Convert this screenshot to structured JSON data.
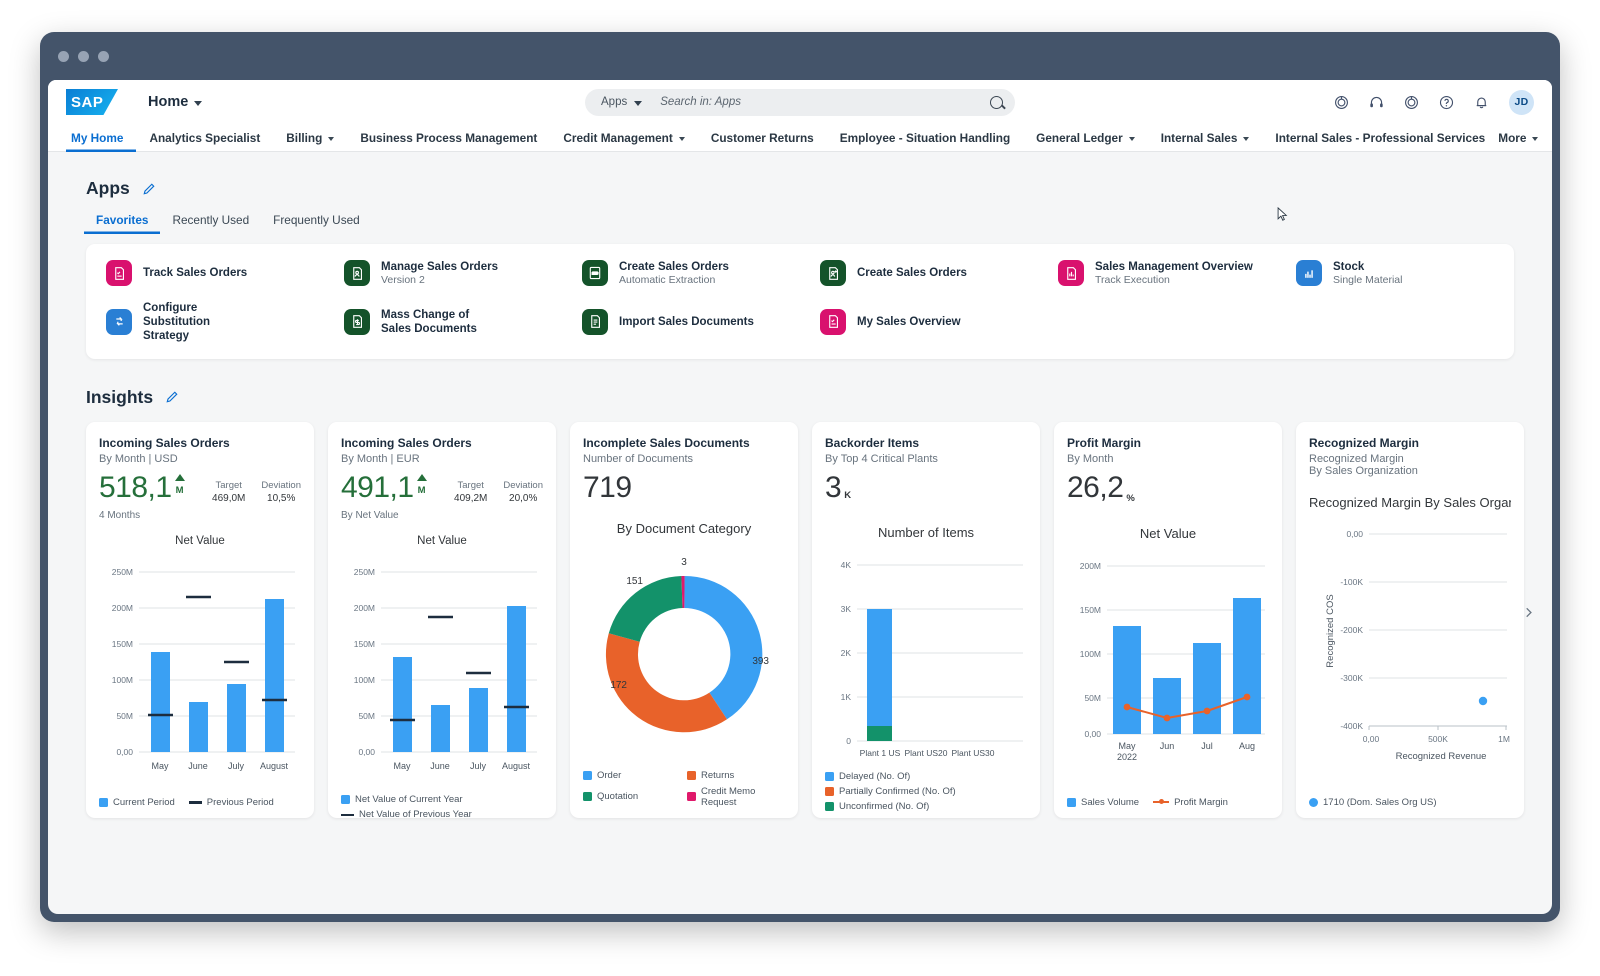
{
  "shell": {
    "logo_text": "SAP",
    "home_label": "Home",
    "search": {
      "scope": "Apps",
      "placeholder": "Search in: Apps",
      "value": ""
    },
    "icons": [
      {
        "name": "spiral-icon",
        "title": "Spiral"
      },
      {
        "name": "headset-icon",
        "title": "Support"
      },
      {
        "name": "spiral2-icon",
        "title": "Copilot"
      },
      {
        "name": "help-icon",
        "title": "Help"
      },
      {
        "name": "bell-icon",
        "title": "Notifications"
      }
    ],
    "avatar_initials": "JD"
  },
  "nav": {
    "items": [
      {
        "label": "My Home",
        "active": true,
        "caret": false
      },
      {
        "label": "Analytics Specialist",
        "active": false,
        "caret": false
      },
      {
        "label": "Billing",
        "active": false,
        "caret": true
      },
      {
        "label": "Business Process Management",
        "active": false,
        "caret": false
      },
      {
        "label": "Credit Management",
        "active": false,
        "caret": true
      },
      {
        "label": "Customer Returns",
        "active": false,
        "caret": false
      },
      {
        "label": "Employee - Situation Handling",
        "active": false,
        "caret": false
      },
      {
        "label": "General Ledger",
        "active": false,
        "caret": true
      },
      {
        "label": "Internal Sales",
        "active": false,
        "caret": true
      },
      {
        "label": "Internal Sales - Professional Services",
        "active": false,
        "caret": false
      }
    ],
    "more_label": "More"
  },
  "apps_section": {
    "title": "Apps",
    "tabs": [
      {
        "label": "Favorites",
        "active": true
      },
      {
        "label": "Recently Used",
        "active": false
      },
      {
        "label": "Frequently Used",
        "active": false
      }
    ],
    "items": [
      {
        "title": "Track Sales Orders",
        "sub": "",
        "color": "#d9116e",
        "icon": "track-sales-orders-icon"
      },
      {
        "title": "Manage Sales Orders",
        "sub": "Version 2",
        "color": "#14532a",
        "icon": "manage-sales-orders-icon"
      },
      {
        "title": "Create Sales Orders",
        "sub": "Automatic Extraction",
        "color": "#14532a",
        "icon": "pdf-icon"
      },
      {
        "title": "Create Sales Orders",
        "sub": "",
        "color": "#14532a",
        "icon": "create-sales-orders-icon"
      },
      {
        "title": "Sales Management Overview",
        "sub": "Track Execution",
        "color": "#d9116e",
        "icon": "sales-overview-icon"
      },
      {
        "title": "Stock",
        "sub": "Single Material",
        "color": "#2a7fd4",
        "icon": "stock-bars-icon"
      },
      {
        "title": "Configure Substitution Strategy",
        "sub": "",
        "color": "#2a7fd4",
        "icon": "substitution-icon"
      },
      {
        "title": "Mass Change of Sales Documents",
        "sub": "",
        "color": "#14532a",
        "icon": "mass-change-icon"
      },
      {
        "title": "Import Sales Documents",
        "sub": "",
        "color": "#14532a",
        "icon": "import-docs-icon"
      },
      {
        "title": "My Sales Overview",
        "sub": "",
        "color": "#d9116e",
        "icon": "my-sales-overview-icon"
      }
    ]
  },
  "insights_section": {
    "title": "Insights"
  },
  "chart_data": [
    {
      "card_title": "Incoming Sales Orders",
      "card_sub": "By Month | USD",
      "kpi": {
        "value": "518,1",
        "unit": "M",
        "trend": "up",
        "footer": "4 Months"
      },
      "meta": [
        {
          "label": "Target",
          "value": "469,0M"
        },
        {
          "label": "Deviation",
          "value": "10,5%"
        }
      ],
      "type": "bar",
      "title": "Net Value",
      "categories": [
        "May",
        "June",
        "July",
        "August"
      ],
      "series": [
        {
          "name": "Current Period",
          "values": [
            139,
            70,
            95,
            213
          ],
          "color": "#3aa0f3"
        },
        {
          "name": "Previous Period",
          "values": [
            52,
            216,
            125,
            73
          ],
          "color": "#1d2d3e"
        }
      ],
      "ytick_labels": [
        "250M",
        "200M",
        "150M",
        "100M",
        "50M",
        "0,00"
      ],
      "ylim": [
        0,
        250
      ],
      "legend": [
        {
          "label": "Current Period",
          "marker": "square",
          "color": "#3aa0f3"
        },
        {
          "label": "Previous Period",
          "marker": "line",
          "color": "#1d2d3e"
        }
      ]
    },
    {
      "card_title": "Incoming Sales Orders",
      "card_sub": "By Month | EUR",
      "kpi": {
        "value": "491,1",
        "unit": "M",
        "trend": "up",
        "footer": "By Net Value"
      },
      "meta": [
        {
          "label": "Target",
          "value": "409,2M"
        },
        {
          "label": "Deviation",
          "value": "20,0%"
        }
      ],
      "type": "bar",
      "title": "Net Value",
      "categories": [
        "May",
        "June",
        "July",
        "August"
      ],
      "series": [
        {
          "name": "Net Value of Current Year",
          "values": [
            132,
            65,
            89,
            203
          ],
          "color": "#3aa0f3"
        },
        {
          "name": "Net Value of Previous Year",
          "values": [
            45,
            188,
            110,
            63
          ],
          "color": "#1d2d3e"
        }
      ],
      "ytick_labels": [
        "250M",
        "200M",
        "150M",
        "100M",
        "50M",
        "0,00"
      ],
      "ylim": [
        0,
        250
      ],
      "legend": [
        {
          "label": "Net Value of Current Year",
          "marker": "square",
          "color": "#3aa0f3"
        },
        {
          "label": "Net Value of Previous Year",
          "marker": "line",
          "color": "#1d2d3e"
        }
      ]
    },
    {
      "card_title": "Incomplete Sales Documents",
      "card_sub": "Number of Documents",
      "kpi": {
        "value": "719",
        "unit": "",
        "trend": "none",
        "footer": ""
      },
      "meta": [],
      "type": "pie",
      "title": "By Document Category",
      "categories": [
        "Order",
        "Returns",
        "Quotation",
        "Credit Memo Request"
      ],
      "values": [
        393,
        172,
        151,
        3
      ],
      "colors": [
        "#3aa0f3",
        "#e8622a",
        "#13926a",
        "#e0196b"
      ],
      "data_labels": [
        "393",
        "172",
        "151",
        "3"
      ],
      "legend": [
        {
          "label": "Order",
          "marker": "square",
          "color": "#3aa0f3"
        },
        {
          "label": "Returns",
          "marker": "square",
          "color": "#e8622a"
        },
        {
          "label": "Quotation",
          "marker": "square",
          "color": "#13926a"
        },
        {
          "label": "Credit Memo Request",
          "marker": "square",
          "color": "#e0196b"
        }
      ]
    },
    {
      "card_title": "Backorder Items",
      "card_sub": "By Top 4 Critical Plants",
      "kpi": {
        "value": "3",
        "unit": "K",
        "trend": "none",
        "footer": ""
      },
      "meta": [],
      "type": "bar",
      "title": "Number of Items",
      "categories": [
        "Plant 1 US",
        "Plant US20",
        "Plant US30"
      ],
      "series": [
        {
          "name": "Delayed (No. Of)",
          "values": [
            2650,
            0,
            0
          ],
          "color": "#3aa0f3"
        },
        {
          "name": "Partially Confirmed (No. Of)",
          "values": [
            0,
            0,
            0
          ],
          "color": "#e8622a"
        },
        {
          "name": "Unconfirmed (No. Of)",
          "values": [
            350,
            0,
            0
          ],
          "color": "#13926a"
        }
      ],
      "ytick_labels": [
        "4K",
        "3K",
        "2K",
        "1K",
        "0"
      ],
      "ylim": [
        0,
        4000
      ],
      "legend": [
        {
          "label": "Delayed (No. Of)",
          "marker": "square",
          "color": "#3aa0f3"
        },
        {
          "label": "Partially Confirmed (No. Of)",
          "marker": "square",
          "color": "#e8622a"
        },
        {
          "label": "Unconfirmed (No. Of)",
          "marker": "square",
          "color": "#13926a"
        }
      ]
    },
    {
      "card_title": "Profit Margin",
      "card_sub": "By Month",
      "kpi": {
        "value": "26,2",
        "unit": "%",
        "trend": "none",
        "footer": ""
      },
      "meta": [],
      "type": "combo",
      "title": "Net Value",
      "categories": [
        "May",
        "Jun",
        "Jul",
        "Aug"
      ],
      "xaxis_note": "2022",
      "series": [
        {
          "name": "Sales Volume",
          "values": [
            123,
            64,
            104,
            155
          ],
          "color": "#3aa0f3",
          "kind": "bar"
        },
        {
          "name": "Profit Margin",
          "values": [
            31,
            18,
            26,
            42
          ],
          "color": "#e8622a",
          "kind": "line"
        }
      ],
      "ytick_labels": [
        "200M",
        "150M",
        "100M",
        "50M",
        "0,00"
      ],
      "ylim": [
        0,
        200
      ],
      "legend": [
        {
          "label": "Sales Volume",
          "marker": "square",
          "color": "#3aa0f3"
        },
        {
          "label": "Profit Margin",
          "marker": "linedot",
          "color": "#e8622a"
        }
      ]
    },
    {
      "card_title": "Recognized Margin",
      "card_sub": "Recognized Margin",
      "card_sub2": "By Sales Organization",
      "kpi": {
        "value": "",
        "unit": "",
        "trend": "none",
        "footer": ""
      },
      "meta": [],
      "type": "scatter",
      "title": "Recognized Margin By Sales Organz...",
      "xlabel": "Recognized Revenue",
      "ylabel": "Recognized COS",
      "xtick_labels": [
        "0,00",
        "500K",
        "1M"
      ],
      "ytick_labels": [
        "0,00",
        "-100K",
        "-200K",
        "-300K",
        "-400K"
      ],
      "xlim": [
        0,
        1000000
      ],
      "ylim": [
        -400000,
        0
      ],
      "points": [
        {
          "x": 830000,
          "y": -345000,
          "color": "#3aa0f3"
        }
      ],
      "legend": [
        {
          "label": "1710 (Dom. Sales Org US)",
          "marker": "dot",
          "color": "#3aa0f3"
        }
      ]
    }
  ]
}
